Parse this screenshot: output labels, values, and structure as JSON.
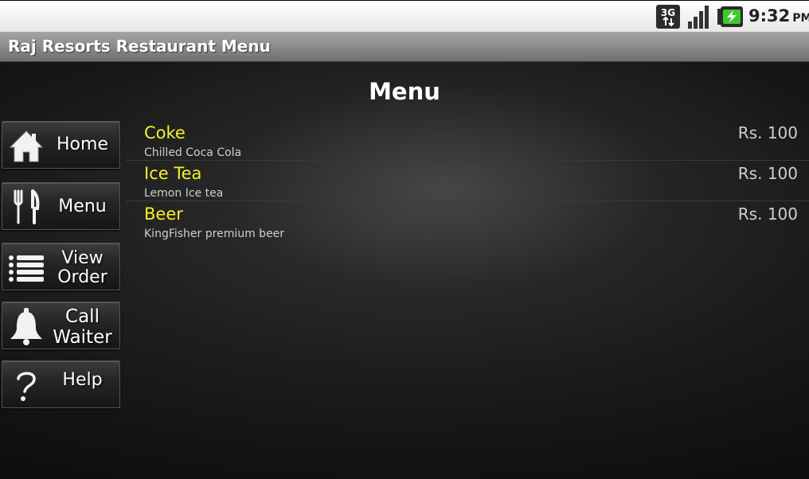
{
  "status_bar": {
    "network_label": "3G",
    "time": "9:32",
    "ampm": "PM",
    "battery_color": "#41c82f"
  },
  "app": {
    "title": "Raj Resorts Restaurant Menu"
  },
  "page": {
    "title": "Menu"
  },
  "nav": {
    "items": [
      {
        "label": "Home",
        "icon": "home-icon"
      },
      {
        "label": "Menu",
        "icon": "fork-knife-icon"
      },
      {
        "label_line1": "View",
        "label_line2": "Order",
        "icon": "list-icon"
      },
      {
        "label_line1": "Call",
        "label_line2": "Waiter",
        "icon": "bell-icon"
      },
      {
        "label": "Help",
        "icon": "question-icon"
      }
    ]
  },
  "menu_items": [
    {
      "name": "Coke",
      "description": "Chilled Coca Cola",
      "price": "Rs. 100"
    },
    {
      "name": "Ice Tea",
      "description": "Lemon Ice tea",
      "price": "Rs. 100"
    },
    {
      "name": "Beer",
      "description": "KingFisher premium beer",
      "price": "Rs. 100"
    }
  ],
  "colors": {
    "item_name": "#f4f130",
    "item_text": "#cfcfcf",
    "title_bar": "#8e8e8e"
  }
}
